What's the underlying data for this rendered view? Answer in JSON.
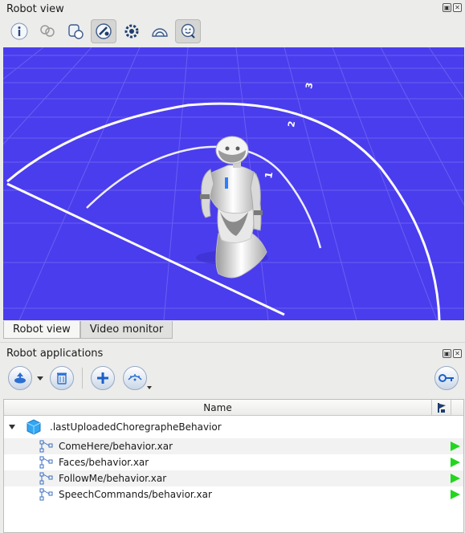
{
  "robot_view": {
    "title": "Robot view",
    "toolbar": [
      {
        "icon": "info-icon"
      },
      {
        "icon": "people-icon"
      },
      {
        "icon": "camera-icon"
      },
      {
        "icon": "robot-tool-icon"
      },
      {
        "icon": "gear-robot-icon"
      },
      {
        "icon": "sonar-icon"
      },
      {
        "icon": "face-search-icon"
      }
    ],
    "scene": {
      "background": "#4a3ded",
      "range_labels": [
        "1",
        "2",
        "3"
      ]
    },
    "tabs": [
      {
        "label": "Robot view",
        "active": true
      },
      {
        "label": "Video monitor",
        "active": false
      }
    ]
  },
  "robot_applications": {
    "title": "Robot applications",
    "table": {
      "header": "Name",
      "root": ".lastUploadedChoregrapheBehavior",
      "items": [
        {
          "label": "ComeHere/behavior.xar"
        },
        {
          "label": "Faces/behavior.xar"
        },
        {
          "label": "FollowMe/behavior.xar"
        },
        {
          "label": "SpeechCommands/behavior.xar"
        }
      ]
    },
    "colors": {
      "play": "#22d61f",
      "accent": "#2a6fd1"
    }
  }
}
